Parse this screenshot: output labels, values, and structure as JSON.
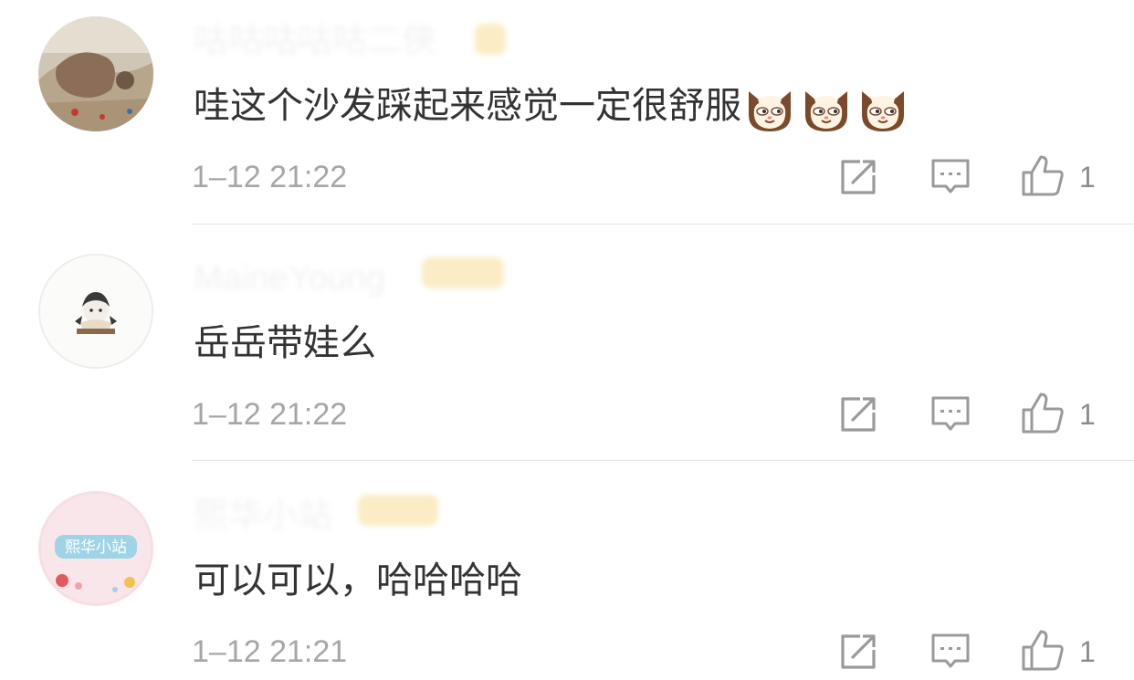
{
  "comments": [
    {
      "username": "咕咕咕咕咕二侠",
      "text": "哇这个沙发踩起来感觉一定很舒服",
      "emojis": [
        "cat-face-icon",
        "cat-face-icon",
        "cat-face-icon"
      ],
      "time": "1–12 21:22",
      "likes": "1",
      "avatar_icon": "painting-avatar"
    },
    {
      "username": "MaineYoung",
      "text": "岳岳带娃么",
      "emojis": [],
      "time": "1–12 21:22",
      "likes": "1",
      "avatar_icon": "cartoon-girl-avatar"
    },
    {
      "username": "熙华小站",
      "text": "可以可以，哈哈哈哈",
      "emojis": [],
      "time": "1–12 21:21",
      "likes": "1",
      "avatar_icon": "pink-logo-avatar",
      "avatar_text": "熙华小站"
    }
  ],
  "icons": {
    "repost": "repost-icon",
    "reply": "reply-icon",
    "like": "thumbs-up-icon"
  },
  "colors": {
    "text": "#333333",
    "meta": "#a6a6a6",
    "icon": "#9a9a9a",
    "divider": "#e6e6e6",
    "badge": "#fbecc6"
  }
}
